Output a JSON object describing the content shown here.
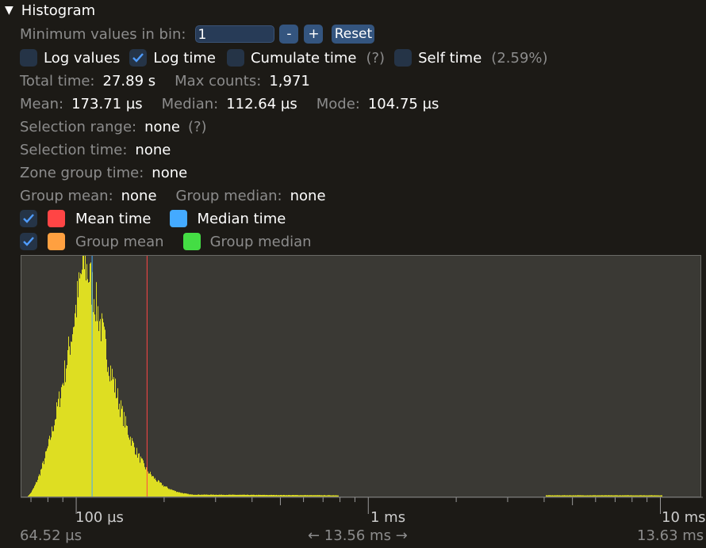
{
  "header": {
    "title": "Histogram"
  },
  "min_values": {
    "label": "Minimum values in bin:",
    "value": "1",
    "minus": "-",
    "plus": "+",
    "reset": "Reset"
  },
  "options": {
    "log_values": "Log values",
    "log_time": "Log time",
    "cumulate_time": "Cumulate time",
    "cumulate_help": "(?)",
    "self_time": "Self time",
    "self_pct": "(2.59%)"
  },
  "stats": {
    "total_time_label": "Total time:",
    "total_time": "27.89 s",
    "max_counts_label": "Max counts:",
    "max_counts": "1,971",
    "mean_label": "Mean:",
    "mean": "173.71 µs",
    "median_label": "Median:",
    "median": "112.64 µs",
    "mode_label": "Mode:",
    "mode": "104.75 µs",
    "selection_range_label": "Selection range:",
    "selection_range": "none",
    "selection_help": "(?)",
    "selection_time_label": "Selection time:",
    "selection_time": "none",
    "zone_group_time_label": "Zone group time:",
    "zone_group_time": "none",
    "group_mean_label": "Group mean:",
    "group_mean": "none",
    "group_median_label": "Group median:",
    "group_median": "none"
  },
  "legend": {
    "mean_time": "Mean time",
    "median_time": "Median time",
    "group_mean": "Group mean",
    "group_median": "Group median"
  },
  "colors": {
    "bars": "#dede22",
    "mean": "#ff4545",
    "median": "#44aaff",
    "group_mean": "#ffa040",
    "group_median": "#44dd44"
  },
  "axis": {
    "tick_100us": "100 µs",
    "tick_1ms": "1 ms",
    "tick_10ms": "10 ms",
    "range_min": "64.52 µs",
    "range_span": "← 13.56 ms →",
    "range_max": "13.63 ms"
  },
  "chart_data": {
    "type": "bar",
    "x_scale": "log",
    "x_range_us": [
      64.52,
      13630
    ],
    "mean_us": 173.71,
    "median_us": 112.64,
    "mode_us": 104.75,
    "max_count": 1971
  }
}
